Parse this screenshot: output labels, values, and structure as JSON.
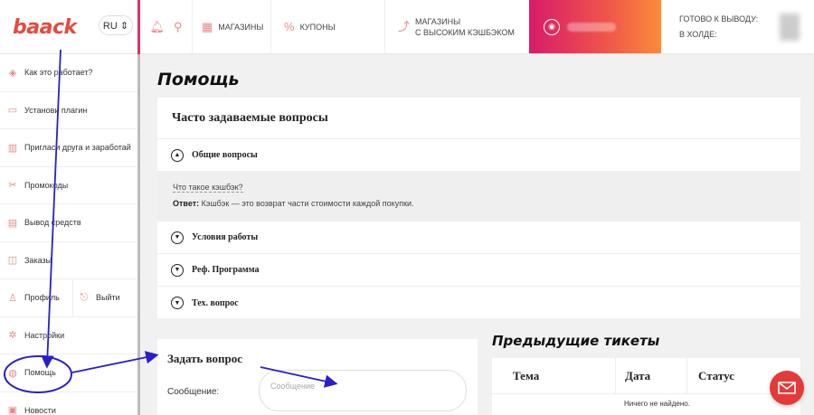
{
  "header": {
    "logo": "baack",
    "lang": "RU ⇕",
    "shops": "МАГАЗИНЫ",
    "coupons": "КУПОНЫ",
    "cashback_line1": "МАГАЗИНЫ",
    "cashback_line2": "С ВЫСОКИМ КЭШБЭКОМ",
    "withdraw_label": "ГОТОВО К ВЫВОДУ:",
    "hold_label": "В ХОЛДЕ:"
  },
  "sidebar": {
    "items": [
      {
        "label": "Как это работает?",
        "icon": "tag-icon"
      },
      {
        "label": "Установи плагин",
        "icon": "monitor-icon"
      },
      {
        "label": "Пригласи друга и заработай",
        "icon": "building-icon"
      },
      {
        "label": "Промокоды",
        "icon": "coupon-icon"
      },
      {
        "label": "Вывод средств",
        "icon": "wallet-icon"
      },
      {
        "label": "Заказы",
        "icon": "bag-icon"
      },
      {
        "label": "Профиль",
        "icon": "user-icon"
      },
      {
        "label": "Выйти",
        "icon": "logout-icon"
      },
      {
        "label": "Настройки",
        "icon": "gear-icon"
      },
      {
        "label": "Помощь",
        "icon": "help-icon"
      },
      {
        "label": "Новости",
        "icon": "news-icon"
      }
    ]
  },
  "page": {
    "title": "Помощь"
  },
  "faq": {
    "title": "Часто задаваемые вопросы",
    "sections": [
      {
        "label": "Общие вопросы"
      },
      {
        "label": "Условия работы"
      },
      {
        "label": "Реф. Программа"
      },
      {
        "label": "Тех. вопрос"
      }
    ],
    "question": "Что такое кэшбэк?",
    "answer_label": "Ответ:",
    "answer_text": " Кэшбэк — это возврат части стоимости каждой покупки."
  },
  "ask": {
    "title": "Задать вопрос",
    "message_label": "Сообщение:",
    "message_placeholder": "Сообщение"
  },
  "tickets": {
    "title": "Предыдущие тикеты",
    "columns": [
      "Тема",
      "Дата",
      "Статус"
    ],
    "empty": "Ничего не найдено."
  },
  "colors": {
    "accent": "#e0306a",
    "gradient_start": "#d81b6a",
    "gradient_end": "#fb8c3b",
    "annotation": "#2a1fc9"
  }
}
